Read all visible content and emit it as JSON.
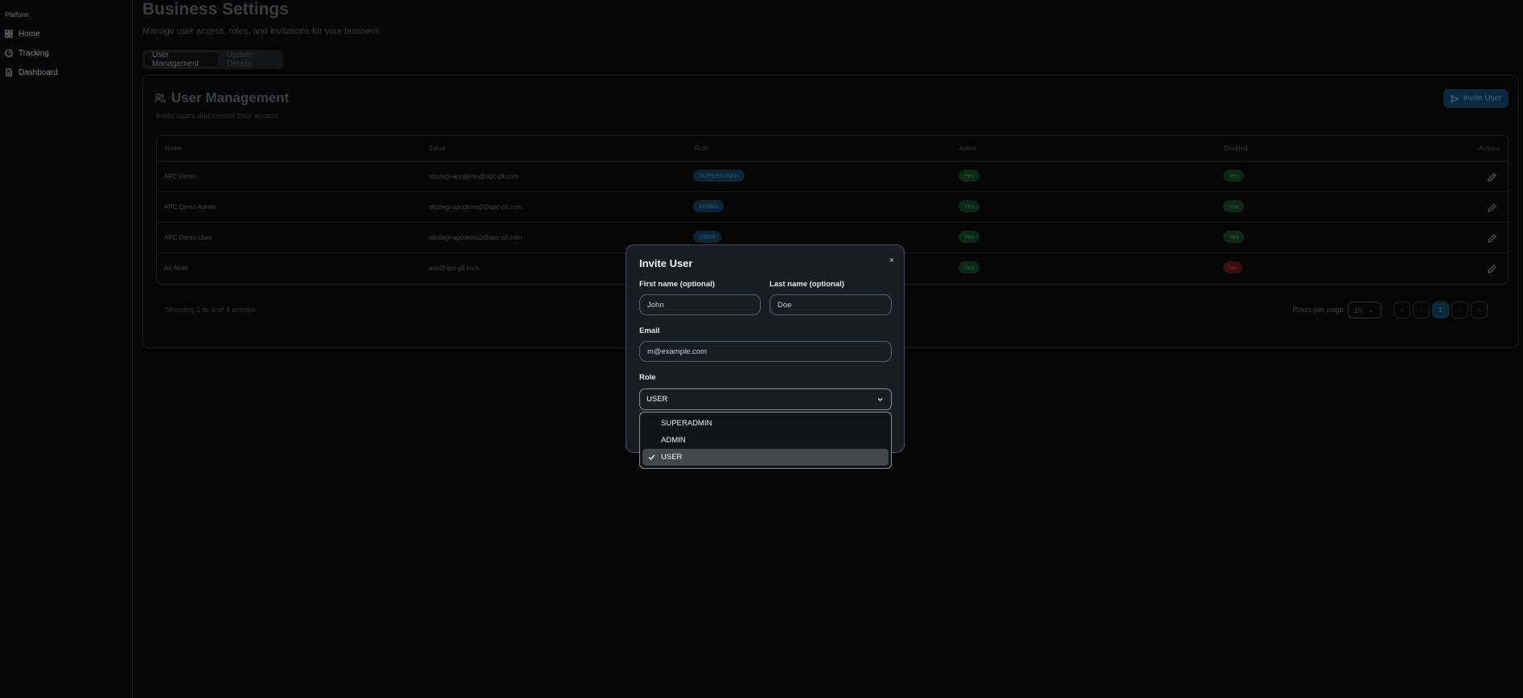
{
  "sidebar": {
    "section": "Platform",
    "items": [
      {
        "label": "Home",
        "icon": "grid-icon"
      },
      {
        "label": "Tracking",
        "icon": "gauge-icon"
      },
      {
        "label": "Dashboard",
        "icon": "file-icon"
      }
    ]
  },
  "page": {
    "title": "Business Settings",
    "subtitle": "Manage user access, roles, and invitations for your business",
    "tabs": [
      {
        "label": "User Management",
        "active": true
      },
      {
        "label": "Update Details",
        "active": false
      }
    ]
  },
  "card": {
    "title": "User Management",
    "subtitle": "Invite users and control their access.",
    "invite_button": "Invite User"
  },
  "table": {
    "headers": [
      "Name",
      "Email",
      "Role",
      "Active",
      "Enabled",
      "Actions"
    ],
    "rows": [
      {
        "name": "APC Demo",
        "email": "nicoleg+apcdemo@apc-pli.com",
        "role": "SUPERADMIN",
        "active": "Yes",
        "enabled": "Yes"
      },
      {
        "name": "APC Demo Admin",
        "email": "nicoleg+apcdemo2@apc-pli.com",
        "role": "ADMIN",
        "active": "Yes",
        "enabled": "Yes"
      },
      {
        "name": "APC Demo User",
        "email": "nicoleg+apcdemo3@apc-pli.com",
        "role": "USER",
        "active": "Yes",
        "enabled": "Yes"
      },
      {
        "name": "Ari Aloni",
        "email": "aria@apc-pli.com",
        "role": "",
        "active": "Yes",
        "enabled": "No"
      }
    ],
    "showing": "Showing 1 to 4 of 4 entries",
    "rows_per_page_label": "Rows per page",
    "rows_per_page": "10",
    "pagination": {
      "first": "«",
      "prev": "‹",
      "current": "1",
      "next": "›",
      "last": "»"
    }
  },
  "modal": {
    "title": "Invite User",
    "close": "×",
    "first_name_label": "First name (optional)",
    "first_name_placeholder": "John",
    "last_name_label": "Last name (optional)",
    "last_name_placeholder": "Doe",
    "email_label": "Email",
    "email_placeholder": "m@example.com",
    "role_label": "Role",
    "role_value": "USER",
    "role_options": [
      "SUPERADMIN",
      "ADMIN",
      "USER"
    ]
  },
  "colors": {
    "accent": "#0b2a3f",
    "modal_bg": "#1a1d20",
    "selected_option_bg": "#41484a"
  }
}
